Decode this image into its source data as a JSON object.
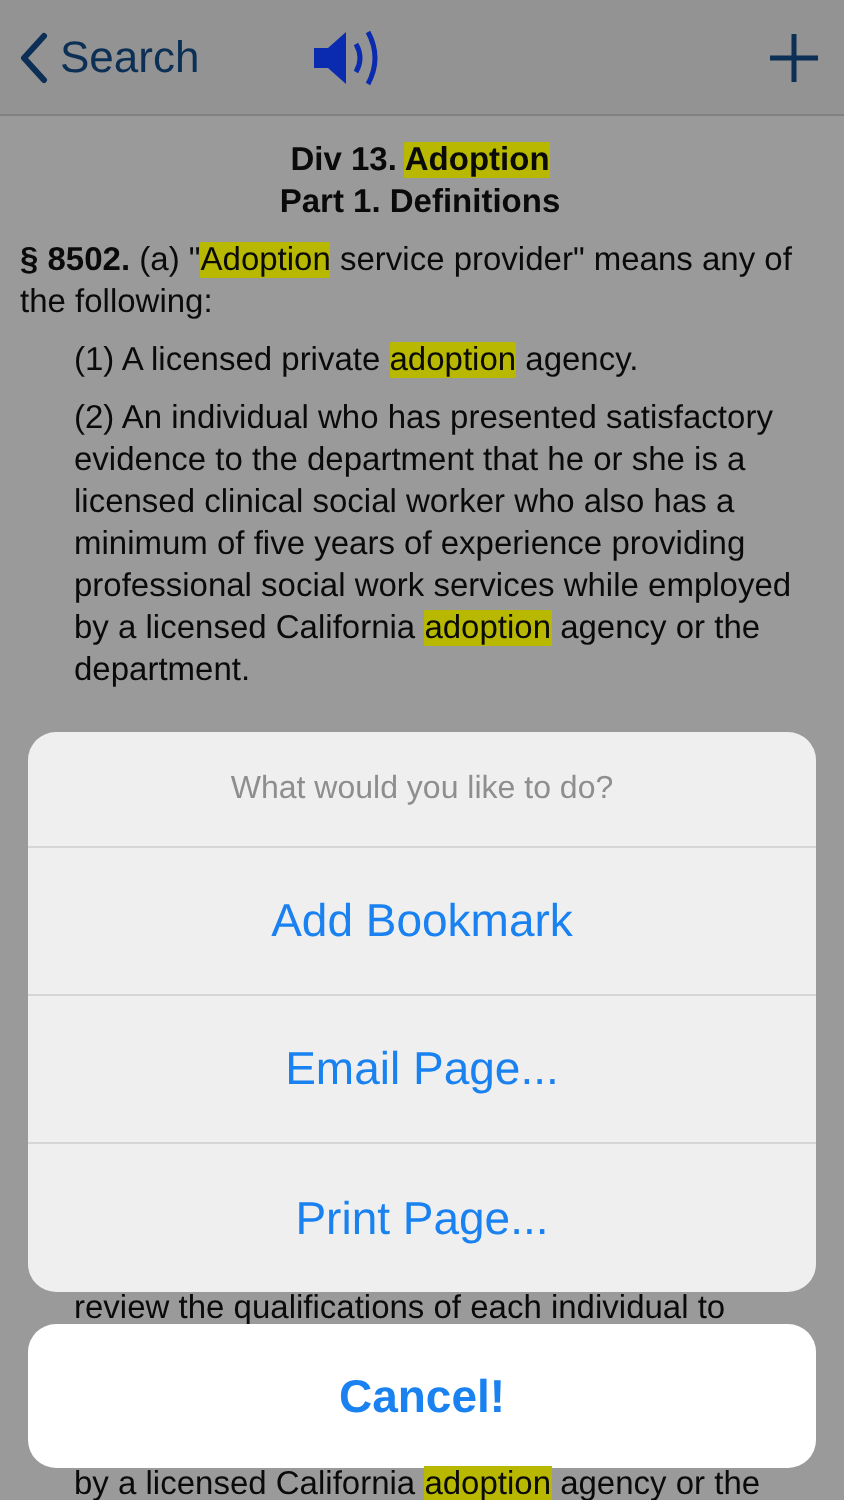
{
  "nav": {
    "back_label": "Search"
  },
  "document": {
    "headings": [
      [
        {
          "text": "Div 13. ",
          "highlighted": false
        },
        {
          "text": "Adoption",
          "highlighted": true
        }
      ],
      [
        {
          "text": "Part 1. Definitions",
          "highlighted": false
        }
      ]
    ],
    "paragraphs": [
      {
        "kind": "section",
        "segments": [
          {
            "text": "**§ 8502.** (a) \"",
            "highlighted": false
          },
          {
            "text": "Adoption",
            "highlighted": true
          },
          {
            "text": " service provider\" means any of the following:",
            "highlighted": false
          }
        ]
      },
      {
        "kind": "item",
        "segments": [
          {
            "text": "(1) A licensed private ",
            "highlighted": false
          },
          {
            "text": "adoption",
            "highlighted": true
          },
          {
            "text": " agency.",
            "highlighted": false
          }
        ]
      },
      {
        "kind": "item",
        "segments": [
          {
            "text": "(2) An individual who has presented satisfactory evidence to the department that he or she is a licensed clinical social worker who also has a minimum of five years of experience providing professional social work services while employed by a licensed California ",
            "highlighted": false
          },
          {
            "text": "adoption",
            "highlighted": true
          },
          {
            "text": " agency or the department.",
            "highlighted": false
          }
        ]
      }
    ],
    "peek_lines": [
      [
        {
          "text": "review the qualifications of each individual to",
          "highlighted": false
        }
      ],
      [
        {
          "text": "by a licensed California ",
          "highlighted": false
        },
        {
          "text": "adoption",
          "highlighted": true
        },
        {
          "text": " agency or the",
          "highlighted": false
        }
      ]
    ]
  },
  "action_sheet": {
    "title": "What would you like to do?",
    "actions": [
      "Add Bookmark",
      "Email Page...",
      "Print Page..."
    ],
    "cancel": "Cancel!"
  }
}
